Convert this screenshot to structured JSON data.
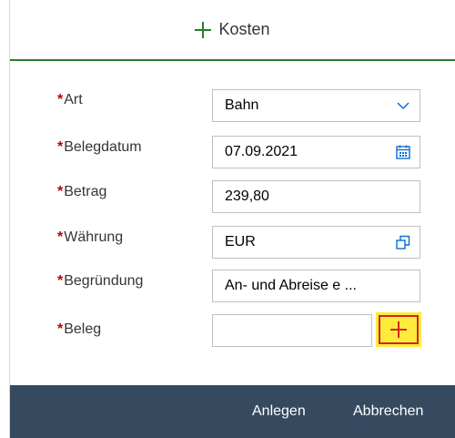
{
  "header": {
    "title": "Kosten"
  },
  "form": {
    "art": {
      "label": "Art",
      "value": "Bahn"
    },
    "belegdatum": {
      "label": "Belegdatum",
      "value": "07.09.2021"
    },
    "betrag": {
      "label": "Betrag",
      "value": "239,80"
    },
    "waehrung": {
      "label": "Währung",
      "value": "EUR"
    },
    "begruendung": {
      "label": "Begründung",
      "value": "An- und Abreise e ..."
    },
    "beleg": {
      "label": "Beleg",
      "value": ""
    },
    "required_marker": "*"
  },
  "footer": {
    "create_label": "Anlegen",
    "cancel_label": "Abbrechen"
  },
  "icons": {
    "header": "plus-icon",
    "art": "chevron-down-icon",
    "belegdatum": "calendar-icon",
    "waehrung": "value-help-icon",
    "beleg_add": "plus-icon"
  },
  "colors": {
    "accent_green": "#2b7c2b",
    "required_red": "#bb0000",
    "footer_bg": "#354a5f",
    "highlight_yellow": "#ffeb3b",
    "highlight_border": "#c62828"
  }
}
